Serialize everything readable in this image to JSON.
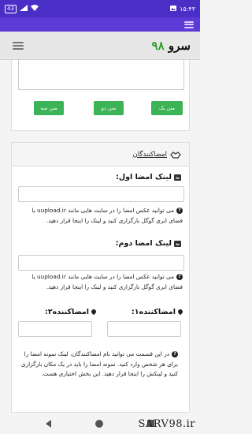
{
  "status": {
    "time": "۱۵:۴۳",
    "badge": "43",
    "signal_icon": "signal-icon",
    "wifi_icon": "wifi-icon"
  },
  "site": {
    "logo_text": "سرو",
    "logo_num": "۹۸"
  },
  "buttons": {
    "text1": "متن یک",
    "text2": "متن دو",
    "text3": "متن سه"
  },
  "signers": {
    "header": "امضاکنندگان",
    "first_link_label": "لینک امضا اول:",
    "first_help": "می توانید عکس امضا را در سایت هایی مانند uupload.ir یا فضای ابری گوگل بارگزاری کنید و لینک را اینجا قرار دهید.",
    "second_link_label": "لینک امضا دوم:",
    "second_help": "می توانید عکس امضا را در سایت هایی مانند uupload.ir یا فضای ابری گوگل بارگزاری کنید و لینک را اینجا قرار دهید.",
    "signer1_label": "امضاکننده۱:",
    "signer2_label": "امضاکننده۲:",
    "footer_help": "در این قسمت می توانید نام امضاکنندگان، لینک نمونه امضا را برای هر شخص وارد کنید. نمونه امضا را باید در یک مکان بارگزاری کنید و لینکش را اینجا قرار دهید. این بخش اختیاری هست."
  },
  "watermark": "SARV98.ir",
  "colors": {
    "statusbar": "#4a2fc6",
    "topbar": "#5b3ad6",
    "button_green": "#3cb356"
  }
}
